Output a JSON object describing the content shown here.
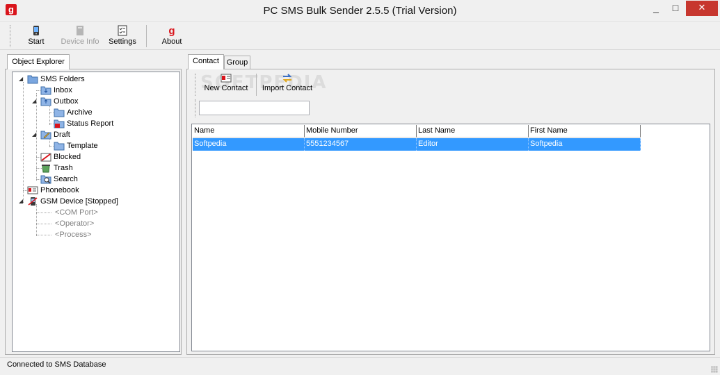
{
  "window": {
    "title": "PC SMS Bulk Sender 2.5.5 (Trial Version)",
    "minimize": "_",
    "maximize": "□",
    "close": "✕"
  },
  "toolbar": {
    "start_label": "Start",
    "device_info_label": "Device Info",
    "settings_label": "Settings",
    "about_label": "About"
  },
  "object_explorer": {
    "tab_label": "Object Explorer",
    "tree": {
      "sms_folders": "SMS Folders",
      "inbox": "Inbox",
      "outbox": "Outbox",
      "archive": "Archive",
      "status_report": "Status Report",
      "draft": "Draft",
      "template": "Template",
      "blocked": "Blocked",
      "trash": "Trash",
      "search": "Search",
      "phonebook": "Phonebook",
      "gsm_device": "GSM Device [Stopped]",
      "com_port": "<COM Port>",
      "operator": "<Operator>",
      "process": "<Process>"
    }
  },
  "contact_panel": {
    "tabs": [
      "Contact",
      "Group"
    ],
    "new_contact_label": "New Contact",
    "import_contact_label": "Import Contact",
    "filter_value": "",
    "watermark": "SOFTPEDIA",
    "columns": [
      "Name",
      "Mobile Number",
      "Last Name",
      "First Name"
    ],
    "rows": [
      [
        "Softpedia",
        "5551234567",
        "Editor",
        "Softpedia"
      ]
    ]
  },
  "status": {
    "text": "Connected to SMS Database"
  },
  "colors": {
    "selection": "#3399ff",
    "close_button": "#c7372f",
    "brand": "#d9141b"
  }
}
